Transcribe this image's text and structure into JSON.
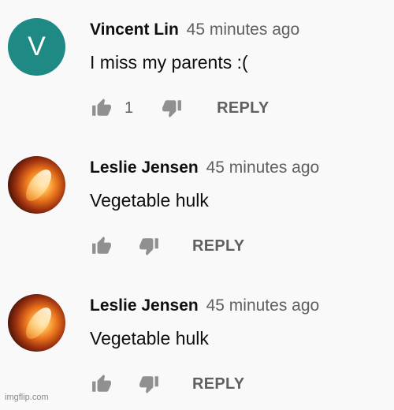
{
  "comments": [
    {
      "author": "Vincent Lin",
      "time": "45 minutes ago",
      "text": "I miss my parents :(",
      "avatar_letter": "V",
      "likes": "1",
      "reply_label": "REPLY"
    },
    {
      "author": "Leslie Jensen",
      "time": "45 minutes ago",
      "text": "Vegetable hulk",
      "reply_label": "REPLY"
    },
    {
      "author": "Leslie Jensen",
      "time": "45 minutes ago",
      "text": "Vegetable hulk",
      "reply_label": "REPLY"
    }
  ],
  "watermark": "imgflip.com",
  "colors": {
    "background": "#f9f9f9",
    "avatar_teal": "#1f8a83",
    "secondary_text": "#606060"
  },
  "icons": {
    "like": "thumbs-up-icon",
    "dislike": "thumbs-down-icon"
  }
}
